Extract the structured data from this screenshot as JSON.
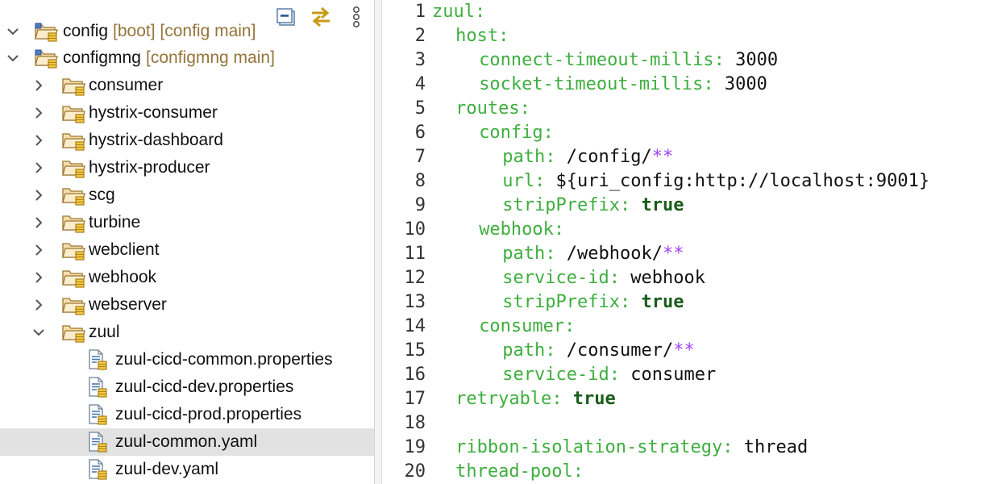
{
  "toolbar": {
    "collapse_icon": "collapse-all-icon",
    "link_icon": "link-with-editor-icon",
    "menu_icon": "view-menu-icon"
  },
  "explorer": {
    "partial_row": {
      "name": "config",
      "decoration": "[boot] [config main]"
    },
    "root": {
      "name": "configmng",
      "decoration": "[configmng main]"
    },
    "folders": [
      "consumer",
      "hystrix-consumer",
      "hystrix-dashboard",
      "hystrix-producer",
      "scg",
      "turbine",
      "webclient",
      "webhook",
      "webserver",
      "zuul"
    ],
    "files": [
      "zuul-cicd-common.properties",
      "zuul-cicd-dev.properties",
      "zuul-cicd-prod.properties",
      "zuul-common.yaml",
      "zuul-dev.yaml"
    ],
    "selected_file": "zuul-common.yaml"
  },
  "editor": {
    "lines": [
      {
        "n": "1",
        "indent": 0,
        "key": "zuul:",
        "value": "",
        "vtype": ""
      },
      {
        "n": "2",
        "indent": 2,
        "key": "host:",
        "value": "",
        "vtype": ""
      },
      {
        "n": "3",
        "indent": 4,
        "key": "connect-timeout-millis:",
        "value": "3000",
        "vtype": "v"
      },
      {
        "n": "4",
        "indent": 4,
        "key": "socket-timeout-millis:",
        "value": "3000",
        "vtype": "v"
      },
      {
        "n": "5",
        "indent": 2,
        "key": "routes:",
        "value": "",
        "vtype": ""
      },
      {
        "n": "6",
        "indent": 4,
        "key": "config:",
        "value": "",
        "vtype": ""
      },
      {
        "n": "7",
        "indent": 6,
        "key": "path:",
        "value": "/config/",
        "vtype": "path"
      },
      {
        "n": "8",
        "indent": 6,
        "key": "url:",
        "value": "${uri_config:http://localhost:9001}",
        "vtype": "v"
      },
      {
        "n": "9",
        "indent": 6,
        "key": "stripPrefix:",
        "value": "true",
        "vtype": "b"
      },
      {
        "n": "10",
        "indent": 4,
        "key": "webhook:",
        "value": "",
        "vtype": ""
      },
      {
        "n": "11",
        "indent": 6,
        "key": "path:",
        "value": "/webhook/",
        "vtype": "path"
      },
      {
        "n": "12",
        "indent": 6,
        "key": "service-id:",
        "value": "webhook",
        "vtype": "v"
      },
      {
        "n": "13",
        "indent": 6,
        "key": "stripPrefix:",
        "value": "true",
        "vtype": "b"
      },
      {
        "n": "14",
        "indent": 4,
        "key": "consumer:",
        "value": "",
        "vtype": ""
      },
      {
        "n": "15",
        "indent": 6,
        "key": "path:",
        "value": "/consumer/",
        "vtype": "path"
      },
      {
        "n": "16",
        "indent": 6,
        "key": "service-id:",
        "value": "consumer",
        "vtype": "v"
      },
      {
        "n": "17",
        "indent": 2,
        "key": "retryable:",
        "value": "true",
        "vtype": "b"
      },
      {
        "n": "18",
        "indent": 0,
        "key": "",
        "value": "",
        "vtype": ""
      },
      {
        "n": "19",
        "indent": 2,
        "key": "ribbon-isolation-strategy:",
        "value": "thread",
        "vtype": "v"
      },
      {
        "n": "20",
        "indent": 2,
        "key": "thread-pool:",
        "value": "",
        "vtype": ""
      }
    ],
    "glob": "**"
  }
}
